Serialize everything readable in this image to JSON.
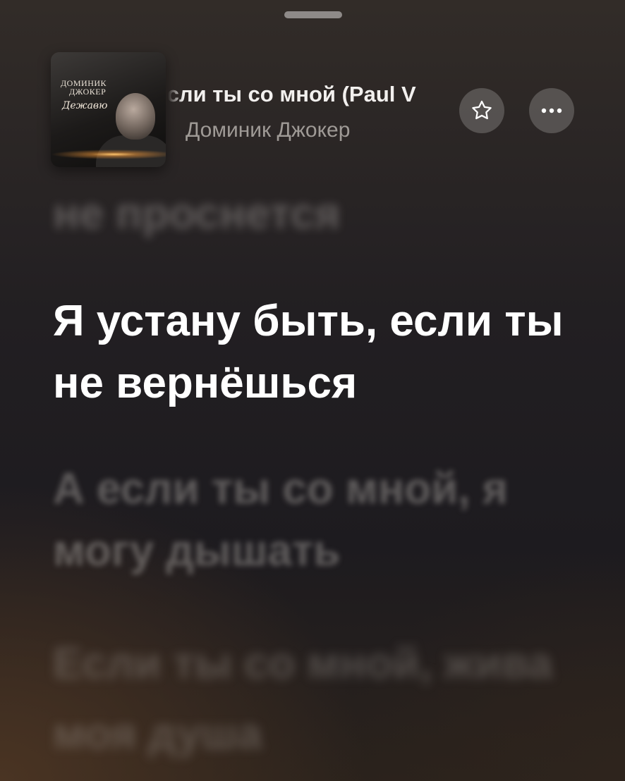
{
  "now_playing": {
    "title": "Если ты со мной (Paul V",
    "artist": "Доминик Джокер",
    "artwork": {
      "line1": "ДОМИНИК",
      "line2": "ДЖОКЕР",
      "script": "Дежавю"
    }
  },
  "actions": {
    "favorite_icon": "star-icon",
    "more_icon": "ellipsis-icon"
  },
  "lyrics": {
    "previous": "не проснется",
    "current": "Я устану быть, если ты не вернёшься",
    "next": [
      "А если ты со мной, я могу дышать",
      "Если ты со мной, жива моя душа"
    ]
  }
}
